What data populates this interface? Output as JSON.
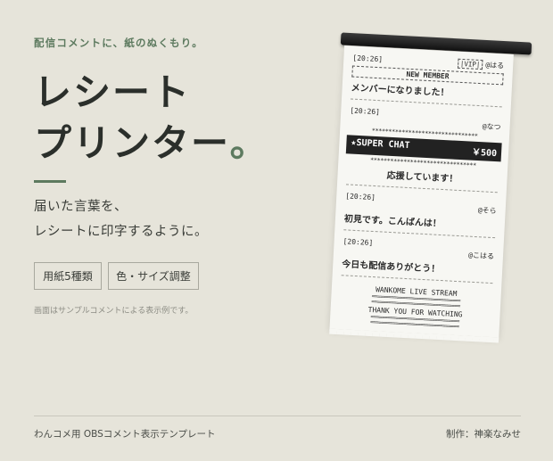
{
  "tagline": "配信コメントに、紙のぬくもり。",
  "title_line1": "レシート",
  "title_line2": "プリンター",
  "title_dot": "。",
  "description_line1": "届いた言葉を、",
  "description_line2": "レシートに印字するように。",
  "features": [
    "用紙5種類",
    "色・サイズ調整"
  ],
  "note": "画面はサンプルコメントによる表示例です。",
  "footer_left": "わんコメ用 OBSコメント表示テンプレート",
  "footer_right": "制作：神楽なみせ",
  "receipt": {
    "msg1": {
      "time": "[20:26]",
      "badge": "|VIP|",
      "user": "@はる",
      "tag": "NEW MEMBER",
      "text": "メンバーになりました！"
    },
    "msg2": {
      "time": "[20:26]",
      "user": "@なつ",
      "stars": "********************************",
      "sc_label": "★SUPER CHAT",
      "sc_amount": "￥500",
      "text": "応援しています！"
    },
    "msg3": {
      "time": "[20:26]",
      "user": "@そら",
      "text": "初見です。こんばんは！"
    },
    "msg4": {
      "time": "[20:26]",
      "user": "@こはる",
      "text": "今日も配信ありがとう！"
    },
    "footer_line1": "WANKOME LIVE STREAM",
    "footer_line2": "THANK YOU FOR WATCHING",
    "rule": "================================"
  }
}
